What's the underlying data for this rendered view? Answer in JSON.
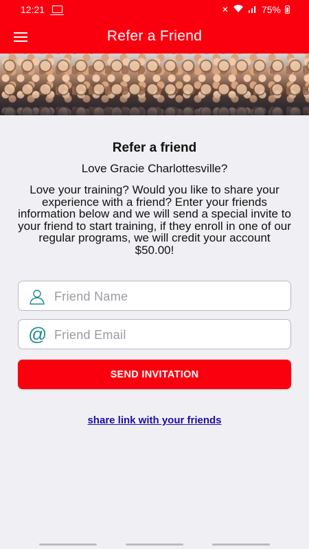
{
  "status_bar": {
    "time": "12:21",
    "battery": "75%",
    "icons": [
      "cast-icon",
      "mute-icon",
      "wifi-icon",
      "signal-icon",
      "battery-icon"
    ]
  },
  "app_bar": {
    "title": "Refer a Friend",
    "menu_icon": "hamburger-menu-icon",
    "color": "#fa000f"
  },
  "banner": {
    "description_icon": "crowd-photo"
  },
  "main": {
    "heading": "Refer a friend",
    "subheading": "Love Gracie Charlottesville?",
    "body": "Love your training? Would you like to share your experience with a friend? Enter your friends information below and we will send a special invite to your friend to start training, if they enroll in one of our regular programs, we will credit your account $50.00!"
  },
  "form": {
    "name_placeholder": "Friend Name",
    "name_icon": "person-icon",
    "email_placeholder": "Friend Email",
    "email_icon": "at-icon",
    "send_label": "SEND INVITATION",
    "share_link_label": "share link with your friends",
    "accent": "#fa000f",
    "icon_color": "#1e8a8a",
    "link_color": "#1a0dab"
  }
}
